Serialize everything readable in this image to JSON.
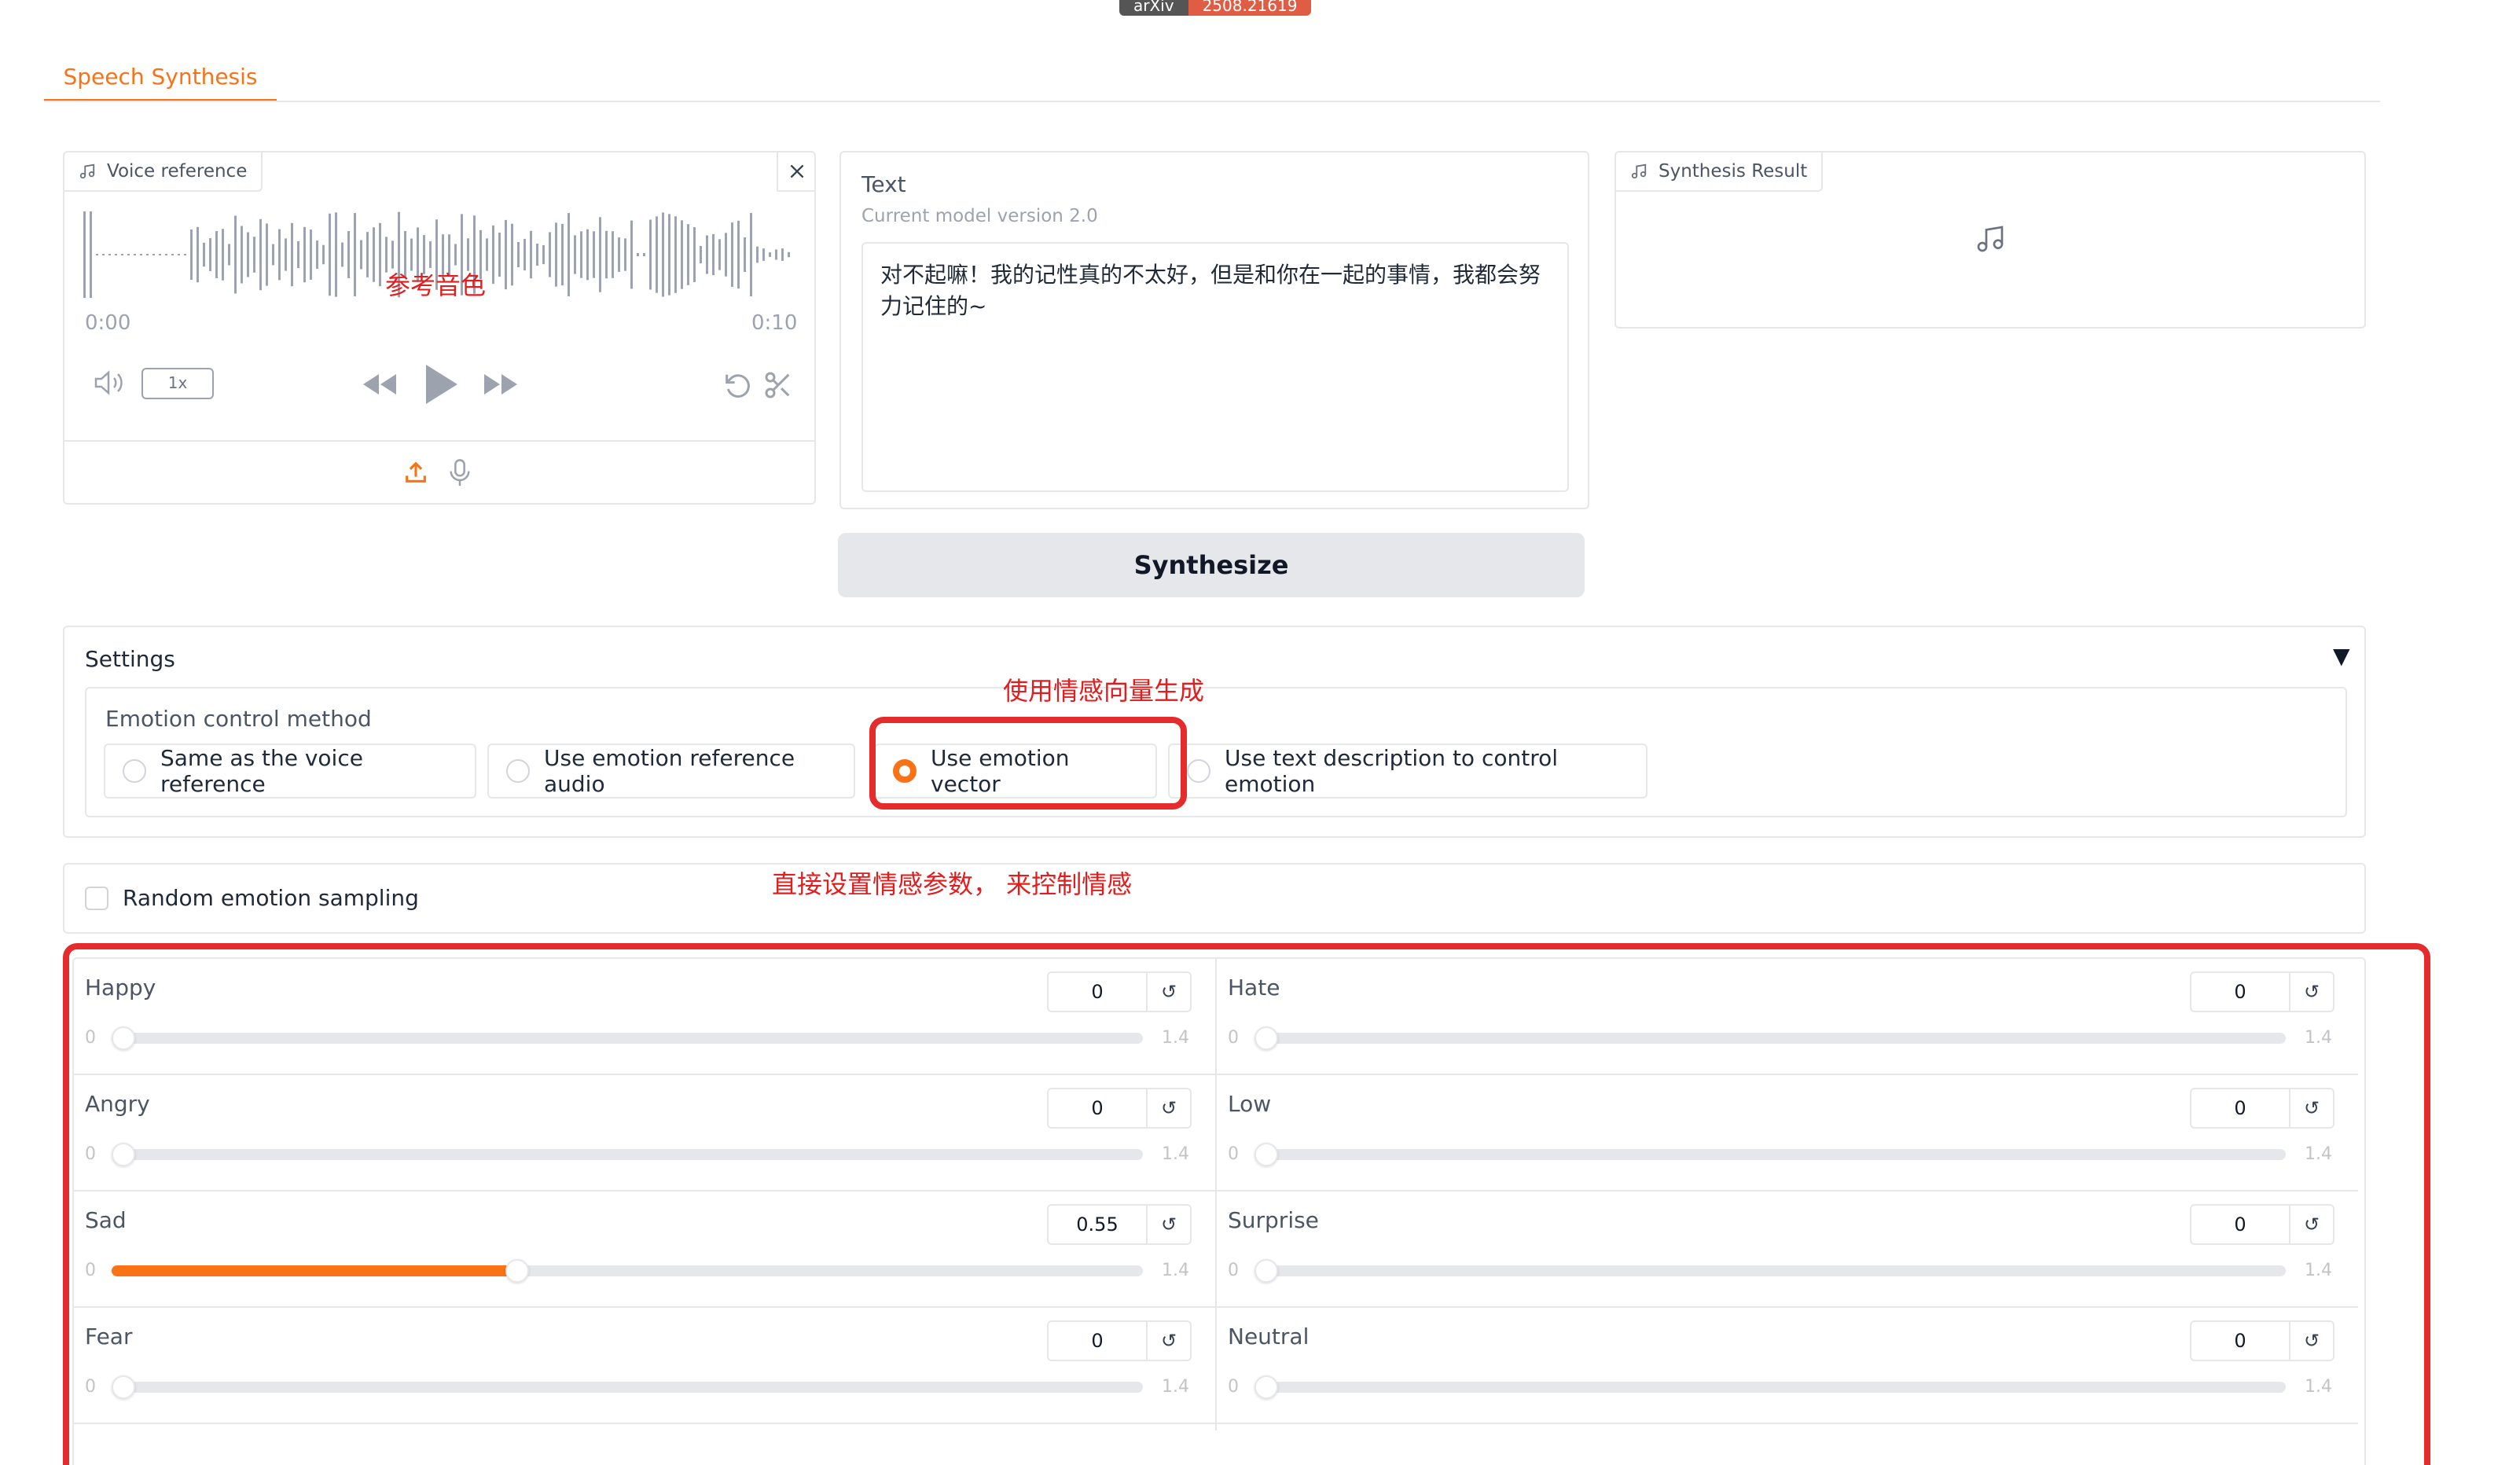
{
  "badge": {
    "left": "arXiv",
    "right": "2508.21619"
  },
  "tabs": [
    {
      "label": "Speech Synthesis",
      "active": true
    }
  ],
  "voice_reference": {
    "label": "Voice reference",
    "time_start": "0:00",
    "time_end": "0:10",
    "speed": "1x",
    "icons": [
      "music-icon",
      "close-icon",
      "volume-icon",
      "rewind-icon",
      "play-icon",
      "fast-forward-icon",
      "undo-icon",
      "scissors-icon",
      "upload-icon",
      "microphone-icon"
    ]
  },
  "text_panel": {
    "label": "Text",
    "info": "Current model version 2.0",
    "value_line1": "对不起嘛！我的记性真的不太好，但是和你在一起的事情，我都会努",
    "value_line2": "力记住的~"
  },
  "result": {
    "label": "Synthesis Result"
  },
  "synthesize_button": "Synthesize",
  "settings": {
    "title": "Settings",
    "toggle": "▼",
    "emotion_method_label": "Emotion control method",
    "options": [
      {
        "label": "Same as the voice reference",
        "selected": false
      },
      {
        "label": "Use emotion reference audio",
        "selected": false
      },
      {
        "label": "Use emotion vector",
        "selected": true
      },
      {
        "label": "Use text description to control emotion",
        "selected": false
      }
    ],
    "random_sampling": {
      "label": "Random emotion sampling",
      "checked": false
    }
  },
  "annotations": {
    "voice": "参考音色",
    "vector": "使用情感向量生成",
    "direct": "直接设置情感参数， 来控制情感"
  },
  "sliders": [
    {
      "label": "Happy",
      "value": "0",
      "min": "0",
      "max": "1.4",
      "fraction": 0
    },
    {
      "label": "Hate",
      "value": "0",
      "min": "0",
      "max": "1.4",
      "fraction": 0
    },
    {
      "label": "Angry",
      "value": "0",
      "min": "0",
      "max": "1.4",
      "fraction": 0
    },
    {
      "label": "Low",
      "value": "0",
      "min": "0",
      "max": "1.4",
      "fraction": 0
    },
    {
      "label": "Sad",
      "value": "0.55",
      "min": "0",
      "max": "1.4",
      "fraction": 0.393
    },
    {
      "label": "Surprise",
      "value": "0",
      "min": "0",
      "max": "1.4",
      "fraction": 0
    },
    {
      "label": "Fear",
      "value": "0",
      "min": "0",
      "max": "1.4",
      "fraction": 0
    },
    {
      "label": "Neutral",
      "value": "0",
      "min": "0",
      "max": "1.4",
      "fraction": 0
    }
  ],
  "reset_glyph": "↺",
  "colors": {
    "accent": "#f97316",
    "annotation": "#e52b2b"
  }
}
